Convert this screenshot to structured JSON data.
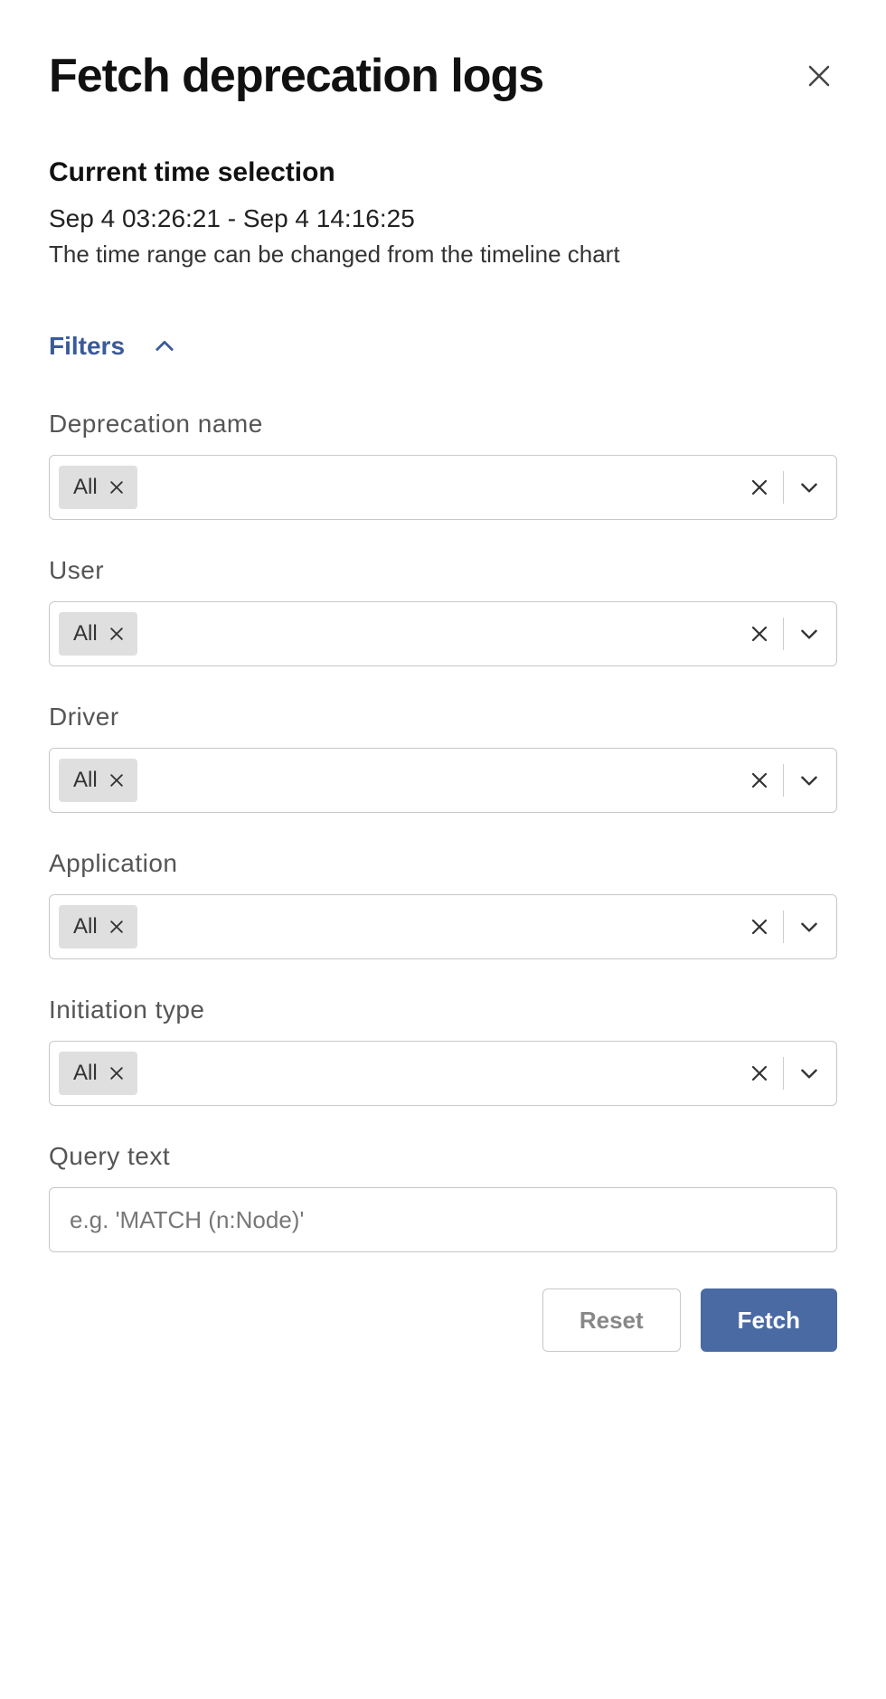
{
  "header": {
    "title": "Fetch deprecation logs"
  },
  "time_selection": {
    "label": "Current time selection",
    "range": "Sep 4 03:26:21 - Sep 4 14:16:25",
    "hint": "The time range can be changed from the timeline chart"
  },
  "filters_section": {
    "label": "Filters",
    "expanded": true
  },
  "filters": [
    {
      "key": "deprecation_name",
      "label": "Deprecation name",
      "chip": "All"
    },
    {
      "key": "user",
      "label": "User",
      "chip": "All"
    },
    {
      "key": "driver",
      "label": "Driver",
      "chip": "All"
    },
    {
      "key": "application",
      "label": "Application",
      "chip": "All"
    },
    {
      "key": "initiation_type",
      "label": "Initiation type",
      "chip": "All"
    }
  ],
  "query_text": {
    "label": "Query text",
    "placeholder": "e.g. 'MATCH (n:Node)'",
    "value": ""
  },
  "actions": {
    "reset_label": "Reset",
    "fetch_label": "Fetch"
  }
}
